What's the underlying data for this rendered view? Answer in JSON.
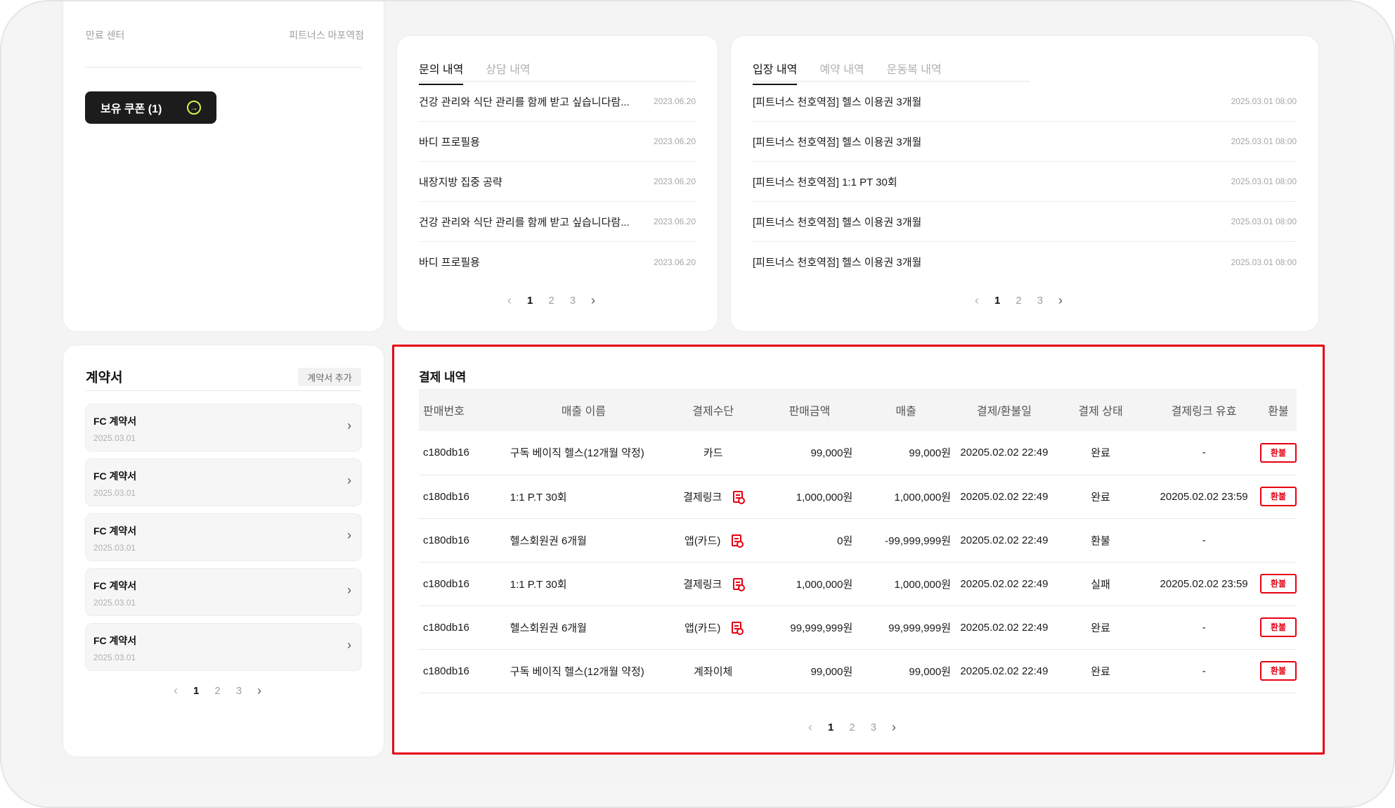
{
  "profile": {
    "expire_label": "만료 센터",
    "center_name": "피트너스 마포역점",
    "coupon_label": "보유 쿠폰 (1)"
  },
  "inquiry": {
    "tabs": [
      "문의 내역",
      "상담 내역"
    ],
    "items": [
      {
        "title": "건강 관리와 식단 관리를 함께 받고 싶습니다람...",
        "date": "2023.06.20"
      },
      {
        "title": "바디 프로필용",
        "date": "2023.06.20"
      },
      {
        "title": "내장지방 집중 공략",
        "date": "2023.06.20"
      },
      {
        "title": "건강 관리와 식단 관리를 함께 받고 싶습니다람...",
        "date": "2023.06.20"
      },
      {
        "title": "바디 프로필용",
        "date": "2023.06.20"
      }
    ],
    "pager": {
      "prev": "‹",
      "pages": [
        "1",
        "2",
        "3"
      ],
      "next": "›"
    }
  },
  "entry": {
    "tabs": [
      "입장 내역",
      "예약 내역",
      "운동복 내역"
    ],
    "items": [
      {
        "title": "[피트너스 천호역점] 헬스 이용권 3개월",
        "date": "2025.03.01 08:00"
      },
      {
        "title": "[피트너스 천호역점] 헬스 이용권 3개월",
        "date": "2025.03.01 08:00"
      },
      {
        "title": "[피트너스 천호역점] 1:1 PT 30회",
        "date": "2025.03.01 08:00"
      },
      {
        "title": "[피트너스 천호역점] 헬스 이용권 3개월",
        "date": "2025.03.01 08:00"
      },
      {
        "title": "[피트너스 천호역점] 헬스 이용권 3개월",
        "date": "2025.03.01 08:00"
      }
    ],
    "pager": {
      "prev": "‹",
      "pages": [
        "1",
        "2",
        "3"
      ],
      "next": "›"
    }
  },
  "contracts": {
    "title": "계약서",
    "add_label": "계약서 추가",
    "items": [
      {
        "title": "FC 계약서",
        "date": "2025.03.01"
      },
      {
        "title": "FC 계약서",
        "date": "2025.03.01"
      },
      {
        "title": "FC 계약서",
        "date": "2025.03.01"
      },
      {
        "title": "FC 계약서",
        "date": "2025.03.01"
      },
      {
        "title": "FC 계약서",
        "date": "2025.03.01"
      }
    ],
    "pager": {
      "prev": "‹",
      "pages": [
        "1",
        "2",
        "3"
      ],
      "next": "›"
    }
  },
  "payments": {
    "title": "결제 내역",
    "columns": [
      "판매번호",
      "매출 이름",
      "결제수단",
      "판매금액",
      "매출",
      "결제/환불일",
      "결제 상태",
      "결제링크 유효",
      "환불"
    ],
    "refund_label": "환불",
    "rows": [
      {
        "id": "c180db16",
        "name": "구독 베이직 헬스(12개월 약정)",
        "method": "카드",
        "doc": false,
        "price": "99,000원",
        "sales": "99,000원",
        "date": "20205.02.02 22:49",
        "status": "완료",
        "link": "-",
        "refund": true
      },
      {
        "id": "c180db16",
        "name": "1:1 P.T 30회",
        "method": "결제링크",
        "doc": true,
        "price": "1,000,000원",
        "sales": "1,000,000원",
        "date": "20205.02.02 22:49",
        "status": "완료",
        "link": "20205.02.02 23:59",
        "refund": true
      },
      {
        "id": "c180db16",
        "name": "헬스회원권 6개월",
        "method": "앱(카드)",
        "doc": true,
        "price": "0원",
        "sales": "-99,999,999원",
        "date": "20205.02.02 22:49",
        "status": "환불",
        "link": "-",
        "refund": false
      },
      {
        "id": "c180db16",
        "name": "1:1 P.T 30회",
        "method": "결제링크",
        "doc": true,
        "price": "1,000,000원",
        "sales": "1,000,000원",
        "date": "20205.02.02 22:49",
        "status": "실패",
        "link": "20205.02.02 23:59",
        "refund": true
      },
      {
        "id": "c180db16",
        "name": "헬스회원권 6개월",
        "method": "앱(카드)",
        "doc": true,
        "price": "99,999,999원",
        "sales": "99,999,999원",
        "date": "20205.02.02 22:49",
        "status": "완료",
        "link": "-",
        "refund": true
      },
      {
        "id": "c180db16",
        "name": "구독 베이직 헬스(12개월 약정)",
        "method": "계좌이체",
        "doc": false,
        "price": "99,000원",
        "sales": "99,000원",
        "date": "20205.02.02 22:49",
        "status": "완료",
        "link": "-",
        "refund": true
      }
    ],
    "pager": {
      "prev": "‹",
      "pages": [
        "1",
        "2",
        "3"
      ],
      "next": "›"
    }
  },
  "colors": {
    "accent": "#e60012",
    "coupon_bg": "#1c1c1c",
    "coupon_icon": "#d6f24a"
  }
}
